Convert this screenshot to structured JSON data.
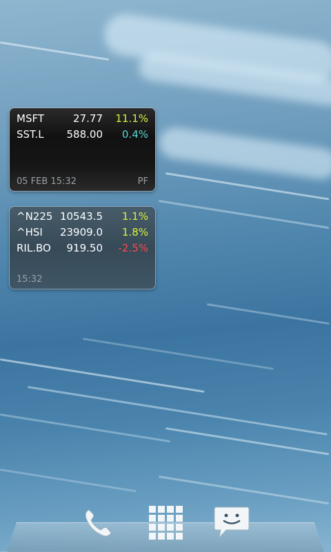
{
  "wallpaper": {
    "name": "blue-light-streaks"
  },
  "widgets": {
    "portfolio": {
      "rows": [
        {
          "symbol": "MSFT",
          "price": "27.77",
          "change": "11.1%",
          "color": "#d9f23a"
        },
        {
          "symbol": "SST.L",
          "price": "588.00",
          "change": "0.4%",
          "color": "#56d6d0"
        }
      ],
      "timestamp": "05 FEB 15:32",
      "tag": "PF"
    },
    "indices": {
      "rows": [
        {
          "symbol": "^N225",
          "price": "10543.5",
          "change": "1.1%",
          "color": "#d9f23a"
        },
        {
          "symbol": "^HSI",
          "price": "23909.0",
          "change": "1.8%",
          "color": "#d9f23a"
        },
        {
          "symbol": "RIL.BO",
          "price": "919.50",
          "change": "-2.5%",
          "color": "#ff4a4a"
        }
      ],
      "timestamp": "15:32"
    }
  },
  "dock": {
    "items": [
      {
        "icon": "phone-icon"
      },
      {
        "icon": "app-drawer-grid-icon"
      },
      {
        "icon": "messaging-icon"
      }
    ]
  }
}
